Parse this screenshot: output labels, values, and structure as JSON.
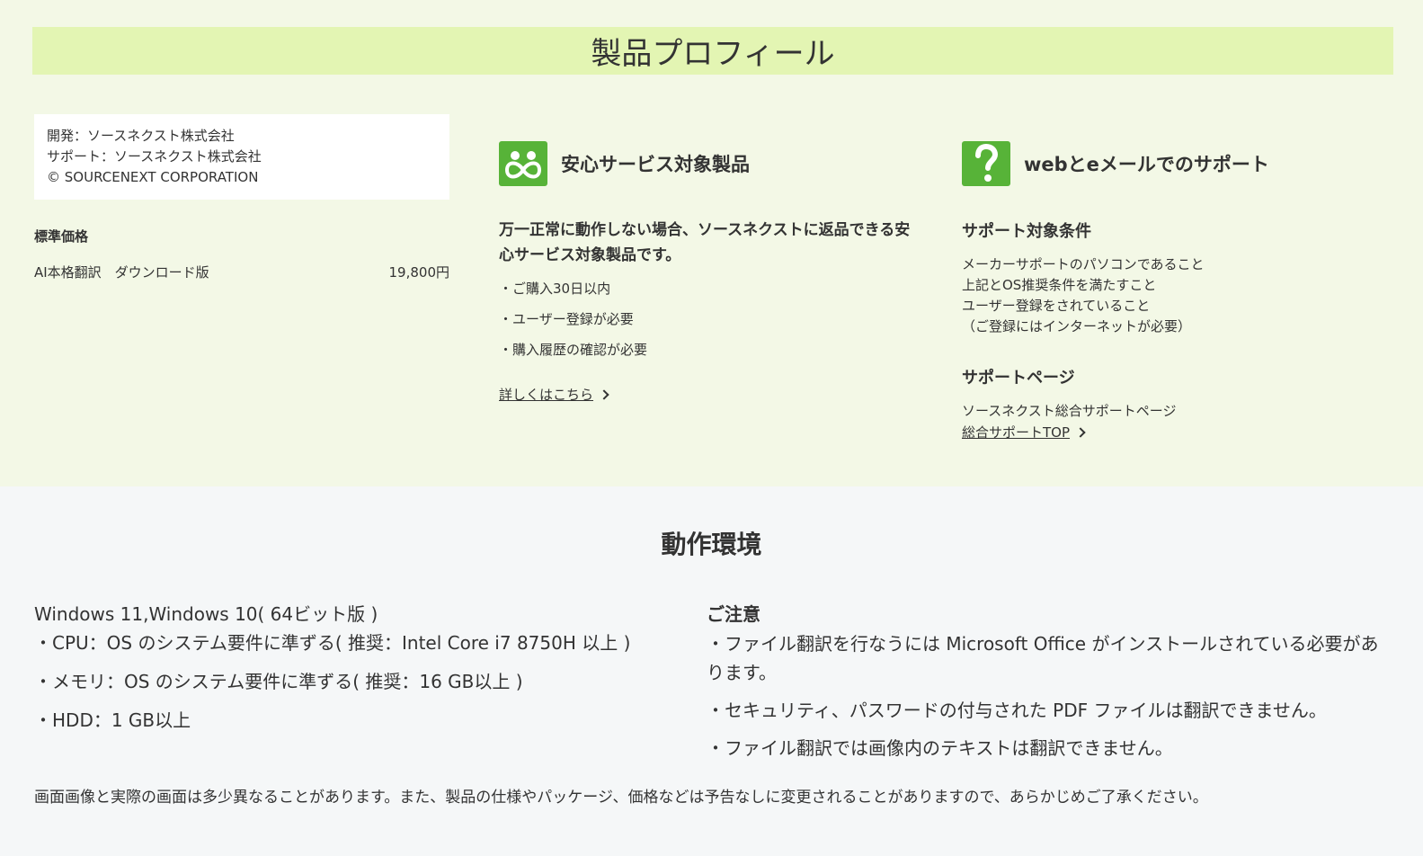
{
  "profile": {
    "title": "製品プロフィール",
    "dev_lines": [
      "開発：ソースネクスト株式会社",
      "サポート：ソースネクスト株式会社",
      "© SOURCENEXT CORPORATION"
    ],
    "price_label": "標準価格",
    "price_item": "AI本格翻訳　ダウンロード版",
    "price_value": "19,800円"
  },
  "safe_service": {
    "icon": "infinity-people-icon",
    "heading": "安心サービス対象製品",
    "lead": "万一正常に動作しない場合、ソースネクストに返品できる安心サービス対象製品です。",
    "items": [
      "・ご購入30日以内",
      "・ユーザー登録が必要",
      "・購入履歴の確認が必要"
    ],
    "link": "詳しくはこちら"
  },
  "support": {
    "icon": "question-mark-icon",
    "heading": "webとeメールでのサポート",
    "conditions_heading": "サポート対象条件",
    "conditions": [
      "メーカーサポートのパソコンであること",
      "上記とOS推奨条件を満たすこと",
      "ユーザー登録をされていること",
      "（ご登録にはインターネットが必要）"
    ],
    "page_heading": "サポートページ",
    "page_text": "ソースネクスト総合サポートページ",
    "page_link": "総合サポートTOP"
  },
  "environment": {
    "title": "動作環境",
    "os": "Windows 11,Windows 10( 64ビット版 )",
    "specs": [
      "・CPU：OS のシステム要件に準ずる( 推奨：Intel Core i7 8750H 以上 )",
      "・メモリ：OS のシステム要件に準ずる( 推奨：16 GB以上 )",
      "・HDD：1 GB以上"
    ],
    "notes_heading": "ご注意",
    "notes": [
      "・ファイル翻訳を行なうには Microsoft Office がインストールされている必要があります。",
      "・セキュリティ、パスワードの付与された PDF ファイルは翻訳できません。",
      "・ファイル翻訳では画像内のテキストは翻訳できません。"
    ]
  },
  "disclaimer": "画面画像と実際の画面は多少異なることがあります。また、製品の仕様やパッケージ、価格などは予告なしに変更されることがありますので、あらかじめご了承ください。",
  "colors": {
    "profile_bg": "#f3f8e6",
    "title_bar": "#e3f5b3",
    "icon_green": "#57b338",
    "env_bg": "#f5f7f8"
  }
}
